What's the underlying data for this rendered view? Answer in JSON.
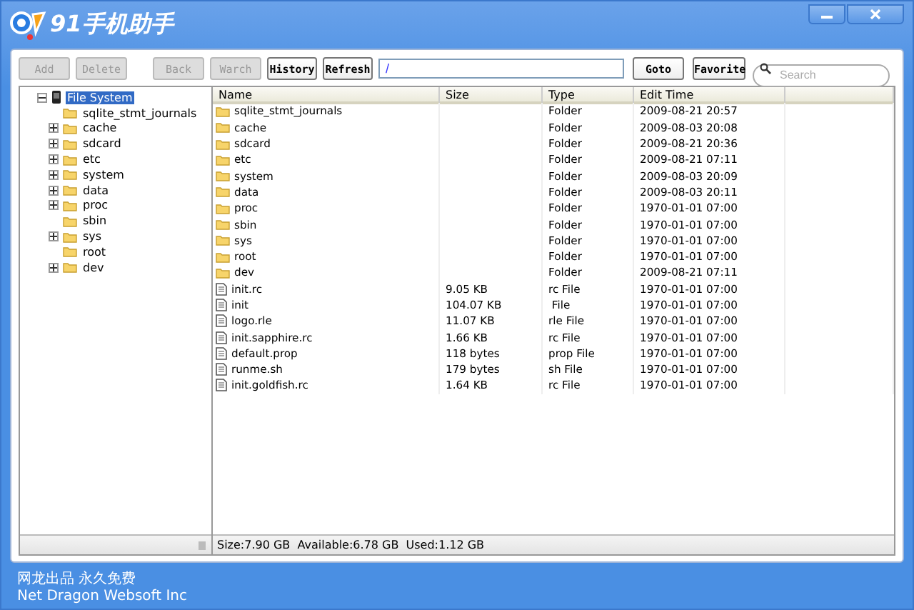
{
  "window": {
    "title": "91手机助手"
  },
  "toolbar": {
    "buttons": [
      {
        "label": "Add",
        "disabled": true
      },
      {
        "label": "Delete",
        "disabled": true
      },
      {
        "label": "Back",
        "disabled": true
      },
      {
        "label": "Warch",
        "disabled": true
      },
      {
        "label": "History",
        "disabled": false
      },
      {
        "label": "Refresh",
        "disabled": false
      }
    ],
    "path": "/",
    "goto": "Goto",
    "favorite": "Favorite",
    "search": {
      "placeholder": "Search"
    }
  },
  "tree": {
    "label": "File System",
    "selected": true,
    "expanded": true,
    "children": [
      {
        "label": "sqlite_stmt_journals",
        "expandable": false
      },
      {
        "label": "cache",
        "expandable": true
      },
      {
        "label": "sdcard",
        "expandable": true
      },
      {
        "label": "etc",
        "expandable": true
      },
      {
        "label": "system",
        "expandable": true
      },
      {
        "label": "data",
        "expandable": true
      },
      {
        "label": "proc",
        "expandable": true
      },
      {
        "label": "sbin",
        "expandable": false
      },
      {
        "label": "sys",
        "expandable": true
      },
      {
        "label": "root",
        "expandable": false
      },
      {
        "label": "dev",
        "expandable": true
      }
    ]
  },
  "table": {
    "columns": [
      "Name",
      "Size",
      "Type",
      "Edit Time"
    ],
    "rows": [
      {
        "kind": "folder",
        "name": "sqlite_stmt_journals",
        "size": "",
        "type": "Folder",
        "time": "2009-08-21 20:57"
      },
      {
        "kind": "folder",
        "name": "cache",
        "size": "",
        "type": "Folder",
        "time": "2009-08-03 20:08"
      },
      {
        "kind": "folder",
        "name": "sdcard",
        "size": "",
        "type": "Folder",
        "time": "2009-08-21 20:36"
      },
      {
        "kind": "folder",
        "name": "etc",
        "size": "",
        "type": "Folder",
        "time": "2009-08-21 07:11"
      },
      {
        "kind": "folder",
        "name": "system",
        "size": "",
        "type": "Folder",
        "time": "2009-08-03 20:09"
      },
      {
        "kind": "folder",
        "name": "data",
        "size": "",
        "type": "Folder",
        "time": "2009-08-03 20:11"
      },
      {
        "kind": "folder",
        "name": "proc",
        "size": "",
        "type": "Folder",
        "time": "1970-01-01 07:00"
      },
      {
        "kind": "folder",
        "name": "sbin",
        "size": "",
        "type": "Folder",
        "time": "1970-01-01 07:00"
      },
      {
        "kind": "folder",
        "name": "sys",
        "size": "",
        "type": "Folder",
        "time": "1970-01-01 07:00"
      },
      {
        "kind": "folder",
        "name": "root",
        "size": "",
        "type": "Folder",
        "time": "1970-01-01 07:00"
      },
      {
        "kind": "folder",
        "name": "dev",
        "size": "",
        "type": "Folder",
        "time": "2009-08-21 07:11"
      },
      {
        "kind": "file",
        "name": "init.rc",
        "size": "9.05 KB",
        "type": "rc File",
        "time": "1970-01-01 07:00"
      },
      {
        "kind": "file",
        "name": "init",
        "size": "104.07 KB",
        "type": " File",
        "time": "1970-01-01 07:00"
      },
      {
        "kind": "file",
        "name": "logo.rle",
        "size": "11.07 KB",
        "type": "rle File",
        "time": "1970-01-01 07:00"
      },
      {
        "kind": "file",
        "name": "init.sapphire.rc",
        "size": "1.66 KB",
        "type": "rc File",
        "time": "1970-01-01 07:00"
      },
      {
        "kind": "file",
        "name": "default.prop",
        "size": "118 bytes",
        "type": "prop File",
        "time": "1970-01-01 07:00"
      },
      {
        "kind": "file",
        "name": "runme.sh",
        "size": "179 bytes",
        "type": "sh File",
        "time": "1970-01-01 07:00"
      },
      {
        "kind": "file",
        "name": "init.goldfish.rc",
        "size": "1.64 KB",
        "type": "rc File",
        "time": "1970-01-01 07:00"
      }
    ]
  },
  "status_bar": "Size:7.90 GB  Available:6.78 GB  Used:1.12 GB",
  "footer": [
    "网龙出品 永久免费",
    "Net Dragon Websoft Inc"
  ]
}
